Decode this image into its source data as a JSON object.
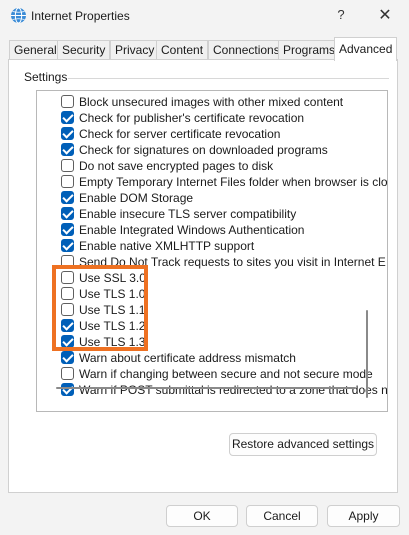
{
  "window": {
    "title": "Internet Properties",
    "help_glyph": "?",
    "close_glyph": "✕"
  },
  "tabs": [
    {
      "label": "General"
    },
    {
      "label": "Security"
    },
    {
      "label": "Privacy"
    },
    {
      "label": "Content"
    },
    {
      "label": "Connections"
    },
    {
      "label": "Programs"
    },
    {
      "label": "Advanced",
      "active": true
    }
  ],
  "settings": {
    "group_label": "Settings",
    "items": [
      {
        "label": "Block unsecured images with other mixed content",
        "checked": false
      },
      {
        "label": "Check for publisher's certificate revocation",
        "checked": true
      },
      {
        "label": "Check for server certificate revocation",
        "checked": true
      },
      {
        "label": "Check for signatures on downloaded programs",
        "checked": true
      },
      {
        "label": "Do not save encrypted pages to disk",
        "checked": false
      },
      {
        "label": "Empty Temporary Internet Files folder when browser is clo",
        "checked": false
      },
      {
        "label": "Enable DOM Storage",
        "checked": true
      },
      {
        "label": "Enable insecure TLS server compatibility",
        "checked": true
      },
      {
        "label": "Enable Integrated Windows Authentication",
        "checked": true
      },
      {
        "label": "Enable native XMLHTTP support",
        "checked": true
      },
      {
        "label": "Send Do Not Track requests to sites you visit in Internet E",
        "checked": false
      },
      {
        "label": "Use SSL 3.0",
        "checked": false
      },
      {
        "label": "Use TLS 1.0",
        "checked": false
      },
      {
        "label": "Use TLS 1.1",
        "checked": false
      },
      {
        "label": "Use TLS 1.2",
        "checked": true
      },
      {
        "label": "Use TLS 1.3",
        "checked": true
      },
      {
        "label": "Warn about certificate address mismatch",
        "checked": true
      },
      {
        "label": "Warn if changing between secure and not secure mode",
        "checked": false
      },
      {
        "label": "Warn if POST submittal is redirected to a zone that does n",
        "checked": true
      }
    ]
  },
  "buttons": {
    "restore": "Restore advanced settings",
    "ok": "OK",
    "cancel": "Cancel",
    "apply": "Apply"
  },
  "colors": {
    "accent": "#005fb8",
    "highlight": "#ee7122"
  }
}
